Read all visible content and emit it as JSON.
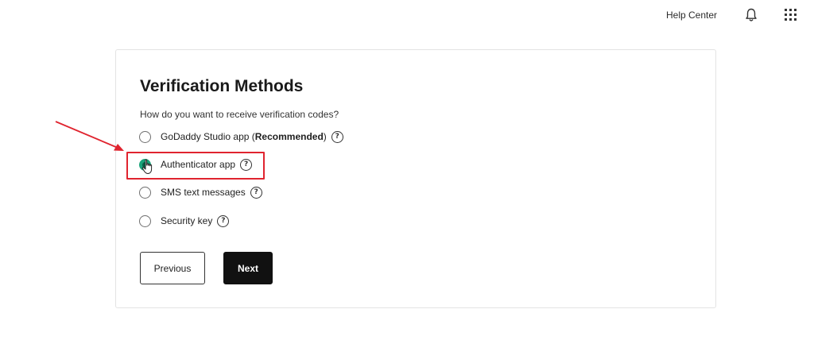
{
  "header": {
    "help_label": "Help Center",
    "icons": {
      "notifications": "bell-icon",
      "apps": "apps-grid-icon"
    }
  },
  "form": {
    "title": "Verification Methods",
    "question": "How do you want to receive verification codes?",
    "options": [
      {
        "label": "GoDaddy Studio app",
        "suffix_open": "(",
        "emphasis": "Recommended",
        "suffix_close": ")",
        "selected": false
      },
      {
        "label": "Authenticator app",
        "selected": true
      },
      {
        "label": "SMS text messages",
        "selected": false
      },
      {
        "label": "Security key",
        "selected": false
      }
    ],
    "help_glyph": "?",
    "previous_label": "Previous",
    "next_label": "Next"
  },
  "colors": {
    "selected_radio": "#1aa37a",
    "annotation": "#e0242f",
    "primary_button": "#111111"
  }
}
